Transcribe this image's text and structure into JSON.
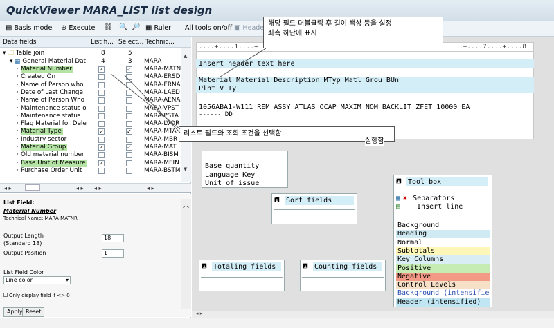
{
  "window": {
    "title": "QuickViewer MARA_LIST list design"
  },
  "toolbar": {
    "basis_mode": "Basis mode",
    "execute": "Execute",
    "ruler": "Ruler",
    "all_tools": "All tools on/off",
    "header": "Header"
  },
  "data_fields": {
    "headers": [
      "Data fields",
      "List fi...",
      "Select...",
      "Technic..."
    ],
    "table_join": {
      "label": "Table join",
      "list": "8",
      "select": "5"
    },
    "general": {
      "label": "General Material Dat",
      "list": "4",
      "select": "3",
      "tech": "MARA"
    },
    "rows": [
      {
        "name": "Material Number",
        "tech": "MARA-MATN",
        "list": true,
        "select": true,
        "hl": true
      },
      {
        "name": "Created On",
        "tech": "MARA-ERSD",
        "list": false,
        "select": false,
        "hl": false
      },
      {
        "name": "Name of Person who",
        "tech": "MARA-ERNA",
        "list": false,
        "select": false,
        "hl": false
      },
      {
        "name": "Date of Last Change",
        "tech": "MARA-LAED",
        "list": false,
        "select": false,
        "hl": false
      },
      {
        "name": "Name of Person Who",
        "tech": "MARA-AENA",
        "list": false,
        "select": false,
        "hl": false
      },
      {
        "name": "Maintenance status o",
        "tech": "MARA-VPST",
        "list": false,
        "select": false,
        "hl": false
      },
      {
        "name": "Maintenance status",
        "tech": "MARA-PSTA",
        "list": false,
        "select": false,
        "hl": false
      },
      {
        "name": "Flag Material for Dele",
        "tech": "MARA-LVOR",
        "list": false,
        "select": false,
        "hl": false
      },
      {
        "name": "Material Type",
        "tech": "MARA-MTA",
        "list": true,
        "select": true,
        "hl": true
      },
      {
        "name": "Industry sector",
        "tech": "MARA-MBR",
        "list": false,
        "select": false,
        "hl": false
      },
      {
        "name": "Material Group",
        "tech": "MARA-MAT",
        "list": true,
        "select": true,
        "hl": true
      },
      {
        "name": "Old material number",
        "tech": "MARA-BISM",
        "list": false,
        "select": false,
        "hl": false
      },
      {
        "name": "Base Unit of Measure",
        "tech": "MARA-MEIN",
        "list": true,
        "select": false,
        "hl": true
      },
      {
        "name": "Purchase Order Unit",
        "tech": "MARA-BSTM",
        "list": false,
        "select": false,
        "hl": false
      }
    ]
  },
  "list_field": {
    "section": "List Field:",
    "field_name": "Material Number",
    "technical_name": "Technical Name: MARA-MATNR",
    "output_length_label": "Output Length",
    "standard": "(Standard 18)",
    "output_length_value": "18",
    "output_position_label": "Output Position",
    "output_position_value": "1",
    "color_label": "List Field Color",
    "color_value": "Line color",
    "only_display": "Only display field if <> 0",
    "apply": "Apply",
    "reset": "Reset"
  },
  "design": {
    "ruler": "....+....1....+",
    "ruler_end": ".+....7....+....8",
    "header_text": "Insert header text here",
    "columns_line1": "Material          Material Description                     MTyp Matl Grou BUn",
    "columns_line2": "Plnt V Ty",
    "data_line": "1056ABA1-W111     REM ASSY ATLAS OCAP MAXIM NOM BACKLIT    ZFET 10000     EA",
    "data_line2": "------ DD"
  },
  "callouts": {
    "top": "해당 필드 더블클릭 후 길이 색상 등을 설정\n좌측 하단에 표시",
    "mid": "리스트 필드와 조회 조건을 선택함",
    "mid_tail": "실행함"
  },
  "field_box": {
    "lines": [
      "Base quantity",
      "Language Key",
      "Unit of issue"
    ]
  },
  "sort_fields": {
    "label": "Sort fields"
  },
  "totaling_fields": {
    "label": "Totaling fields"
  },
  "counting_fields": {
    "label": "Counting fields"
  },
  "tool_box": {
    "label": "Tool box",
    "separators": "Separators",
    "insert_line": "Insert line",
    "colors": [
      {
        "name": "Background",
        "color": "#ffffff",
        "text": "#000000"
      },
      {
        "name": "Heading",
        "color": "#cfeaf2",
        "text": "#000000"
      },
      {
        "name": "Normal",
        "color": "#ffffff",
        "text": "#000000"
      },
      {
        "name": "Subtotals",
        "color": "#fff7b8",
        "text": "#000000"
      },
      {
        "name": "Key Columns",
        "color": "#d8eef4",
        "text": "#000000"
      },
      {
        "name": "Positive",
        "color": "#c6ecb4",
        "text": "#000000"
      },
      {
        "name": "Negative",
        "color": "#f29a86",
        "text": "#000000"
      },
      {
        "name": "Control Levels",
        "color": "#f6e0c8",
        "text": "#000000"
      },
      {
        "name": "Background (intensified)",
        "color": "#ffffff",
        "text": "#2a4fb0"
      },
      {
        "name": "Header (intensified)",
        "color": "#bfe6f2",
        "text": "#000000"
      }
    ]
  }
}
